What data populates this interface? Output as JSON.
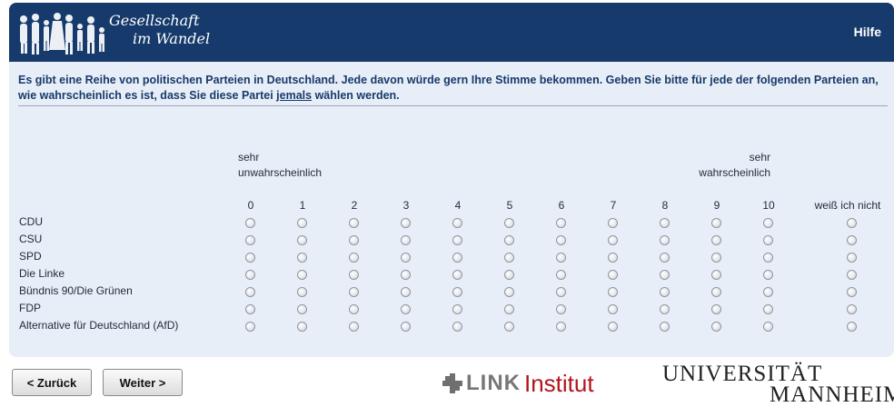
{
  "header": {
    "logo_line1": "Gesellschaft",
    "logo_line2": "im Wandel",
    "help_label": "Hilfe"
  },
  "question": {
    "text_before": "Es gibt eine Reihe von politischen Parteien in Deutschland. Jede davon würde gern Ihre Stimme bekommen. Geben Sie bitte für jede der folgenden Parteien an, wie wahrscheinlich es ist, dass Sie diese Partei ",
    "emphasis": "jemals",
    "text_after": " wählen werden."
  },
  "scale": {
    "anchor_low_1": "sehr",
    "anchor_low_2": "unwahrscheinlich",
    "anchor_high_1": "sehr",
    "anchor_high_2": "wahrscheinlich",
    "points": [
      "0",
      "1",
      "2",
      "3",
      "4",
      "5",
      "6",
      "7",
      "8",
      "9",
      "10"
    ],
    "dont_know": "weiß ich nicht"
  },
  "parties": [
    "CDU",
    "CSU",
    "SPD",
    "Die Linke",
    "Bündnis 90/Die Grünen",
    "FDP",
    "Alternative für Deutschland (AfD)"
  ],
  "buttons": {
    "back": "< Zurück",
    "next": "Weiter >"
  },
  "footer": {
    "link_word": "LINK",
    "link_institut": "Institut",
    "uni_line1": "UNIVERSITÄT",
    "uni_line2": "MANNHEIM"
  },
  "colors": {
    "header_bg": "#163a6b",
    "panel_bg": "#e8eef7",
    "question_text": "#163a6b",
    "link_red": "#b3151b"
  }
}
